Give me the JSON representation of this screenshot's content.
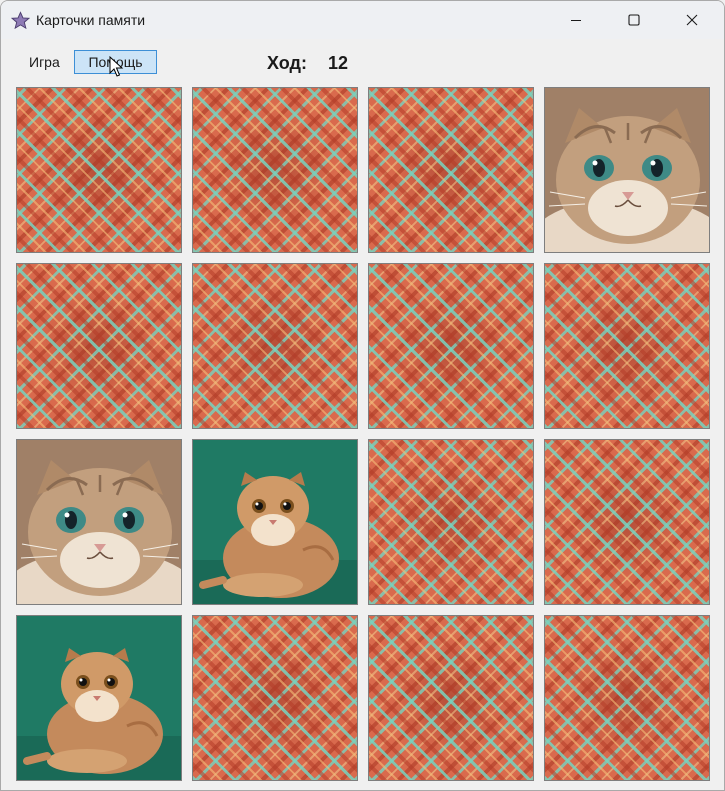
{
  "window": {
    "title": "Карточки памяти",
    "icon": "star-icon",
    "controls": [
      "minimize-icon",
      "maximize-icon",
      "close-icon"
    ]
  },
  "menu": {
    "game_label": "Игра",
    "help_label": "Помощь"
  },
  "status": {
    "move_label": "Ход:",
    "move_count": "12"
  },
  "board": {
    "rows": 4,
    "columns": 4,
    "cards": [
      {
        "state": "face-down"
      },
      {
        "state": "face-down"
      },
      {
        "state": "face-down"
      },
      {
        "state": "face-up",
        "image": "scottish-fold-cat-portrait"
      },
      {
        "state": "face-down"
      },
      {
        "state": "face-down"
      },
      {
        "state": "face-down"
      },
      {
        "state": "face-down"
      },
      {
        "state": "face-up",
        "image": "scottish-fold-cat-portrait"
      },
      {
        "state": "face-up",
        "image": "scottish-fold-kitten-on-green"
      },
      {
        "state": "face-down"
      },
      {
        "state": "face-down"
      },
      {
        "state": "face-up",
        "image": "scottish-fold-kitten-on-green"
      },
      {
        "state": "face-down"
      },
      {
        "state": "face-down"
      },
      {
        "state": "face-down"
      }
    ]
  },
  "colors": {
    "card_back_base": "#d96a4d",
    "card_back_stripe": "#78d2be",
    "menu_highlight": "#cce4f7",
    "menu_highlight_border": "#3d8fd6"
  }
}
